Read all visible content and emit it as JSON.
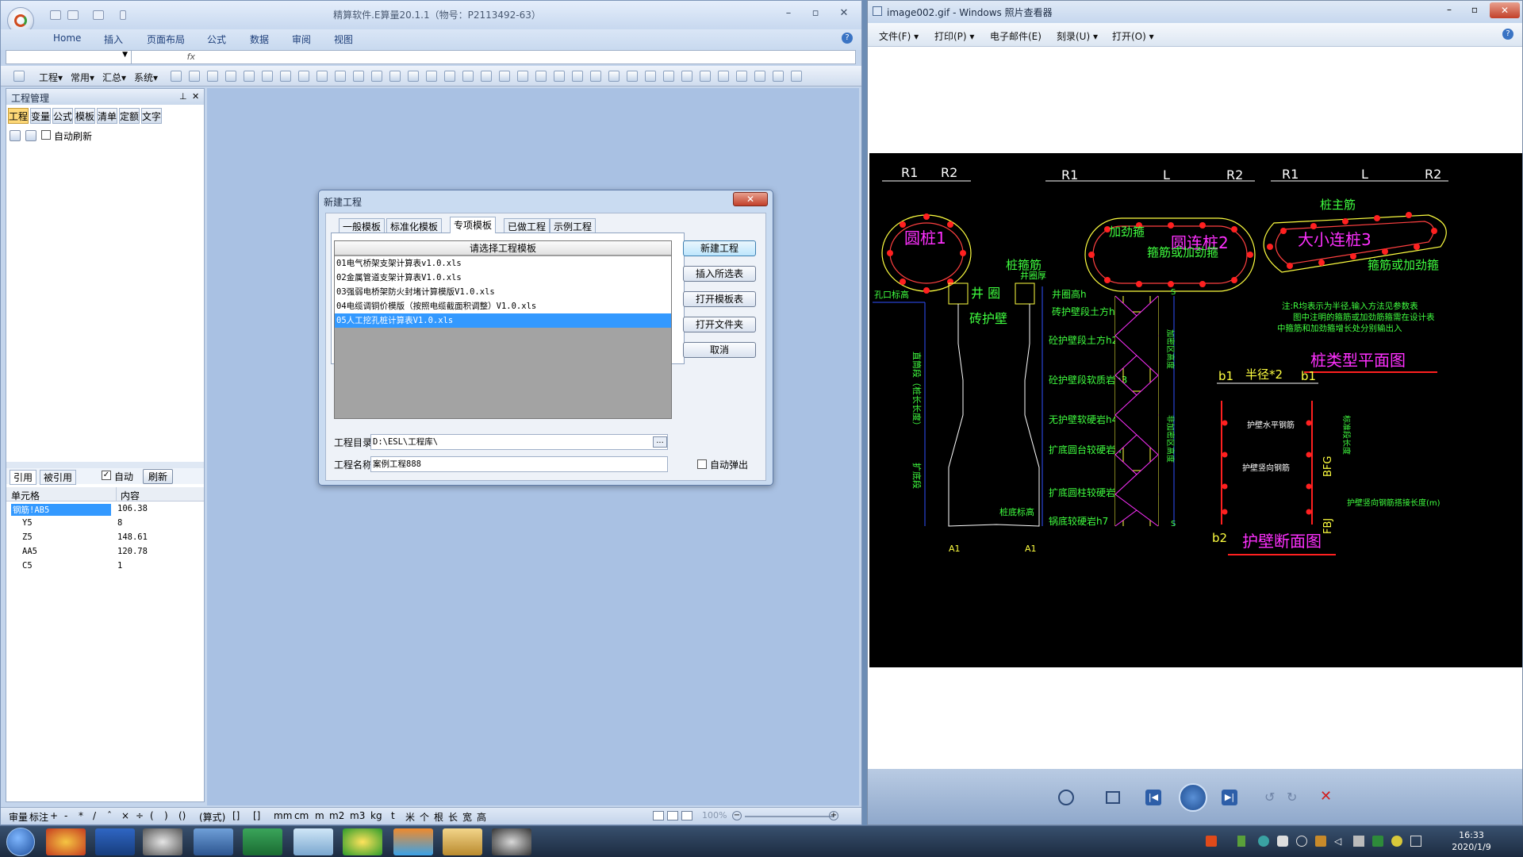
{
  "app": {
    "title": "精算软件.E算量20.1.1（物号：P2113492-63）",
    "menu": [
      "Home",
      "插入",
      "页面布局",
      "公式",
      "数据",
      "审阅",
      "视图"
    ],
    "toolbar_text": [
      "工程",
      "常用",
      "汇总",
      "系统"
    ],
    "panel": {
      "title": "工程管理",
      "tabs": [
        "工程",
        "变量",
        "公式",
        "模板",
        "清单",
        "定额",
        "文字"
      ],
      "auto_refresh": "自动刷新",
      "ref_tabs": [
        "引用",
        "被引用"
      ],
      "auto_label": "自动",
      "refresh_button": "刷新",
      "grid_headers": [
        "单元格",
        "内容"
      ],
      "grid_rows": [
        {
          "cell": "钢筋!AB5",
          "value": "106.38",
          "selected": true
        },
        {
          "cell": "Y5",
          "value": "8"
        },
        {
          "cell": "Z5",
          "value": "148.61"
        },
        {
          "cell": "AA5",
          "value": "120.78"
        },
        {
          "cell": "C5",
          "value": "1"
        }
      ]
    },
    "status": {
      "items": [
        "审量",
        "标注",
        "+",
        "-",
        "*",
        "/",
        "ˆ",
        "×",
        "÷",
        "(",
        ")",
        "()",
        "(算式)",
        "[]",
        "[]",
        "mm",
        "cm",
        "m",
        "m2",
        "m3",
        "kg",
        "t",
        "米",
        "个",
        "根",
        "长",
        "宽",
        "高"
      ],
      "zoom": "100%"
    }
  },
  "dialog": {
    "title": "新建工程",
    "tabs": [
      "一般模板",
      "标准化模板",
      "专项模板",
      "已做工程",
      "示例工程"
    ],
    "active_tab": "专项模板",
    "list_header": "请选择工程模板",
    "items": [
      {
        "label": "01电气桥架支架计算表v1.0.xls"
      },
      {
        "label": "02金属管道支架计算表V1.0.xls"
      },
      {
        "label": "03强弱电桥架防火封堵计算模版V1.0.xls"
      },
      {
        "label": "04电缆调铜价模版（按照电缆截面积调整）V1.0.xls"
      },
      {
        "label": "05人工挖孔桩计算表V1.0.xls",
        "selected": true
      }
    ],
    "buttons": [
      "新建工程",
      "插入所选表",
      "打开模板表",
      "打开文件夹",
      "取消"
    ],
    "dir_label": "工程目录:",
    "dir_value": "D:\\ESL\\工程库\\",
    "dir_button": "...",
    "name_label": "工程名称:",
    "name_value": "案例工程888",
    "auto_popup": "自动弹出"
  },
  "viewer": {
    "title": "image002.gif - Windows 照片查看器",
    "menu": [
      "文件(F)",
      "打印(P)",
      "电子邮件(E)",
      "刻录(U)",
      "打开(O)"
    ],
    "drawing": {
      "plan": {
        "r1": "R1",
        "r2": "R2",
        "l": "L",
        "pile1": "圆桩1",
        "pile2": "圆连桩2",
        "pile3": "大小连桩3",
        "stirrup_add": "加劲箍",
        "stirrup_or": "箍筋或加劲箍",
        "main_bar": "桩主筋",
        "stirrup": "桩箍筋",
        "note1": "注:R均表示为半径,输入方法见参数表",
        "note2": "图中注明的箍筋或加劲筋箍需在设计表",
        "note3": "中箍筋和加劲箍增长处分别输出入",
        "title": "桩类型平面图"
      },
      "section": {
        "hole_top": "孔口标高",
        "well_ring": "井 圈",
        "ring_thick": "井圈厚",
        "brick_wall": "砖护壁",
        "h": "井圈高h",
        "h1": "砖护壁段土方h1",
        "h2": "砼护壁段土方h2",
        "h3": "砼护壁段软质岩h3",
        "h4": "无护壁软硬岩h4",
        "h5": "扩底圆台较硬岩h",
        "h6": "扩底圆柱较硬岩h6",
        "h7": "锅底较硬岩h7",
        "pile_bottom": "桩底标高",
        "straight": "直筒段（桩长长度）",
        "expand": "扩底段",
        "zone1": "加密区高度",
        "zone2": "非加密区高度",
        "s": "S",
        "a1": "A1"
      },
      "wall": {
        "b1": "b1",
        "radius2": "半径*2",
        "b2": "b2",
        "hbar": "护壁水平钢筋",
        "vbar": "护壁竖向钢筋",
        "bfg": "BFG",
        "fbj": "FBJ",
        "std_len": "标准段长度",
        "overlap": "护壁竖向钢筋搭接长度(m)",
        "title": "护壁断面图"
      }
    }
  },
  "taskbar": {
    "time": "16:33",
    "date": "2020/1/9"
  },
  "colors": {
    "accent": "#3399ff",
    "cad_bg": "#000000",
    "cad_red": "#ff2020",
    "cad_yellow": "#ffff40",
    "cad_green": "#40ff40",
    "cad_magenta": "#ff30ff",
    "cad_blue": "#3050ff"
  }
}
